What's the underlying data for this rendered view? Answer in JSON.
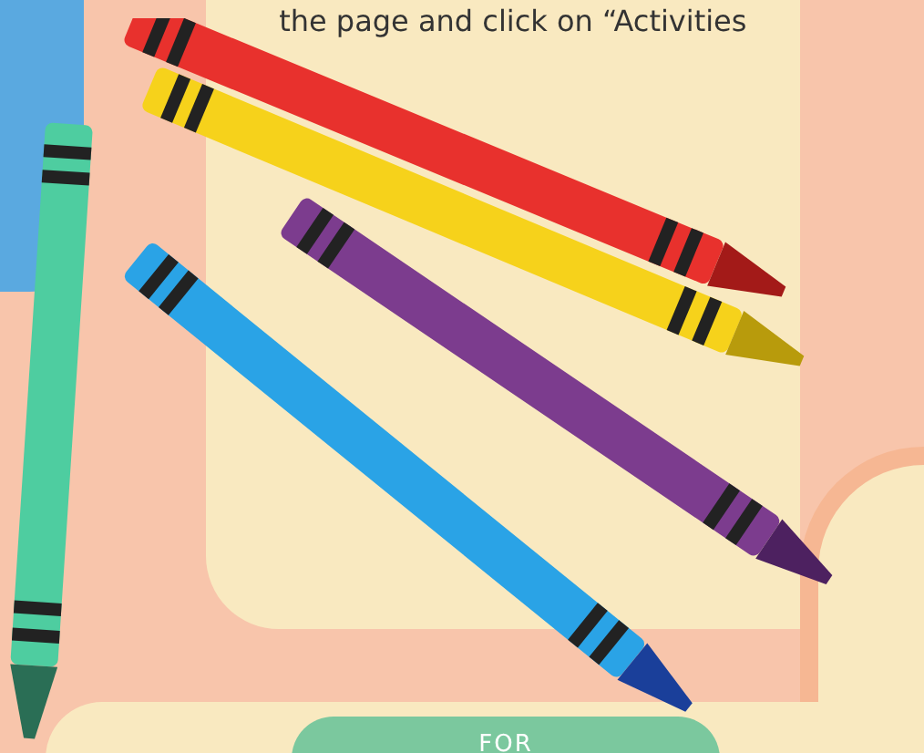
{
  "intro_text": "the page and click on “Activities",
  "audience_badge": "FOR"
}
